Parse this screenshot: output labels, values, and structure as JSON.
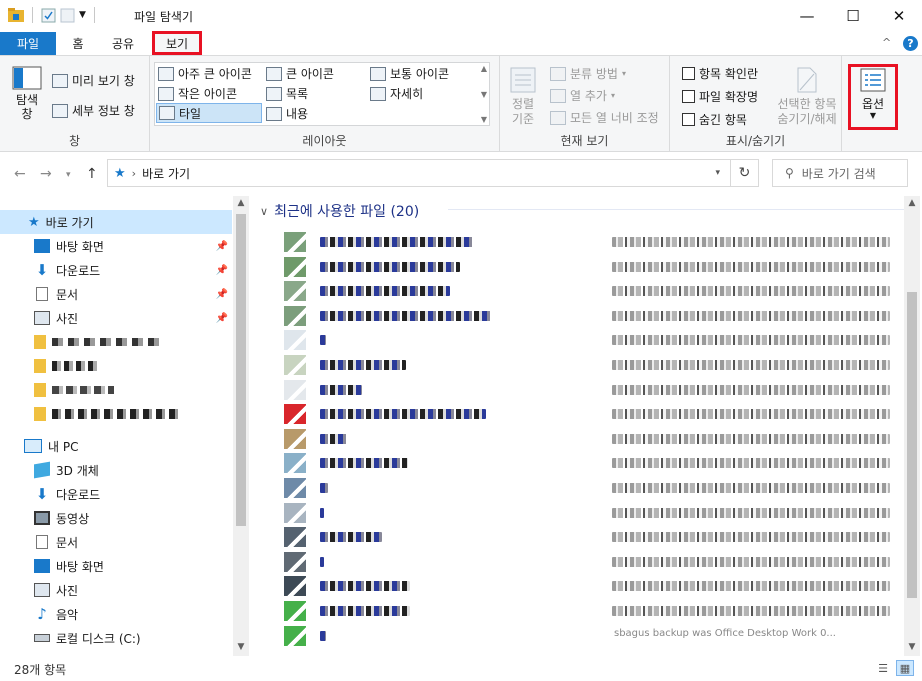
{
  "window": {
    "title": "파일 탐색기",
    "minimize": "—",
    "maximize": "☐",
    "close": "✕"
  },
  "tabs": {
    "file": "파일",
    "home": "홈",
    "share": "공유",
    "view": "보기"
  },
  "ribbon": {
    "collapse": "^",
    "help": "?",
    "pane": {
      "nav_pane": "탐색\n창",
      "preview_pane": "미리 보기 창",
      "details_pane": "세부 정보 창",
      "label": "창"
    },
    "layout": {
      "extra_large_icons": "아주 큰 아이콘",
      "large_icons": "큰 아이콘",
      "medium_icons": "보통 아이콘",
      "small_icons": "작은 아이콘",
      "list": "목록",
      "details": "자세히",
      "tiles": "타일",
      "content": "내용",
      "label": "레이아웃"
    },
    "current_view": {
      "sort_by": "정렬\n기준",
      "group_by": "분류 방법",
      "add_columns": "열 추가",
      "size_all_columns": "모든 열 너비 조정",
      "label": "현재 보기"
    },
    "show_hide": {
      "item_check_boxes": "항목 확인란",
      "file_name_extensions": "파일 확장명",
      "hidden_items": "숨긴 항목",
      "hide_selected": "선택한 항목\n숨기기/해제",
      "label": "표시/숨기기"
    },
    "options": "옵션"
  },
  "address": {
    "path": "바로 가기",
    "search_placeholder": "바로 가기 검색"
  },
  "nav": {
    "quick_access": "바로 가기",
    "qa_items": [
      {
        "label": "바탕 화면",
        "icon": "desktop-folder-icon"
      },
      {
        "label": "다운로드",
        "icon": "download-arrow-icon"
      },
      {
        "label": "문서",
        "icon": "document-icon"
      },
      {
        "label": "사진",
        "icon": "picture-icon"
      }
    ],
    "this_pc": "내 PC",
    "pc_items": [
      {
        "label": "3D 개체",
        "icon": "3d-objects-icon"
      },
      {
        "label": "다운로드",
        "icon": "download-arrow-icon"
      },
      {
        "label": "동영상",
        "icon": "video-icon"
      },
      {
        "label": "문서",
        "icon": "document-icon"
      },
      {
        "label": "바탕 화면",
        "icon": "desktop-folder-icon"
      },
      {
        "label": "사진",
        "icon": "picture-icon"
      },
      {
        "label": "음악",
        "icon": "music-note-icon"
      },
      {
        "label": "로컬 디스크 (C:)",
        "icon": "disk-drive-icon"
      }
    ]
  },
  "content": {
    "group_title": "최근에 사용한 파일 (20)",
    "last_row_path_visible": "sbagus backup was Office Desktop Work 0..."
  },
  "status": {
    "item_count": "28개 항목"
  },
  "colors": {
    "accent": "#1979ca",
    "highlight_red": "#e81123",
    "selection": "#cce8ff",
    "group_header": "#1e3287"
  }
}
